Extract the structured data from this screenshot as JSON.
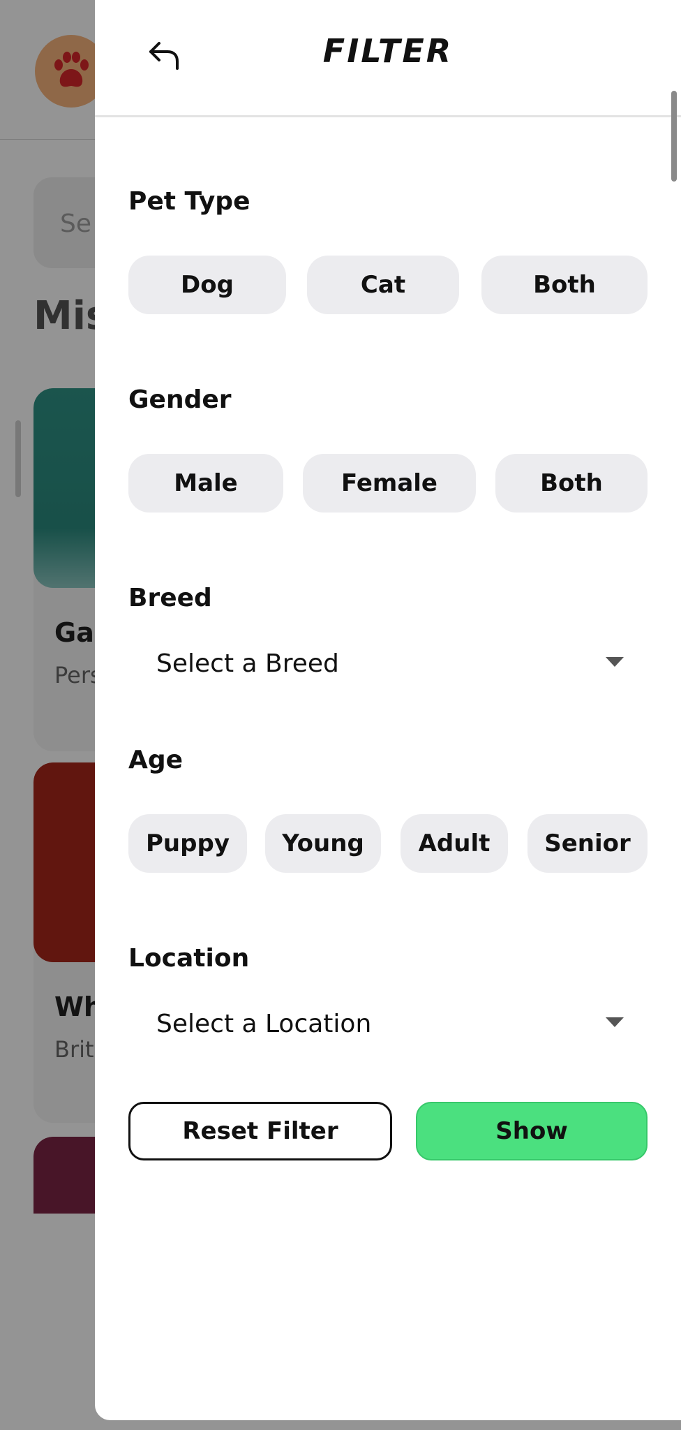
{
  "background": {
    "search_placeholder": "Se",
    "section_title": "Mis",
    "cards": [
      {
        "name": "Ga",
        "sub": "Pers"
      },
      {
        "name": "Wh",
        "sub": "Briti"
      }
    ],
    "card_colors": [
      "#2e8b80",
      "#a8261a",
      "#7d2545"
    ]
  },
  "drawer": {
    "title": "FILTER",
    "back_icon": "undo-arrow-icon",
    "sections": {
      "pet_type": {
        "label": "Pet Type",
        "options": [
          "Dog",
          "Cat",
          "Both"
        ]
      },
      "gender": {
        "label": "Gender",
        "options": [
          "Male",
          "Female",
          "Both"
        ]
      },
      "breed": {
        "label": "Breed",
        "value": "Select a Breed"
      },
      "age": {
        "label": "Age",
        "options": [
          "Puppy",
          "Young",
          "Adult",
          "Senior"
        ]
      },
      "location": {
        "label": "Location",
        "value": "Select a Location"
      }
    },
    "buttons": {
      "reset": "Reset Filter",
      "show": "Show"
    }
  },
  "colors": {
    "accent": "#4be07f",
    "chip": "#ececef"
  }
}
